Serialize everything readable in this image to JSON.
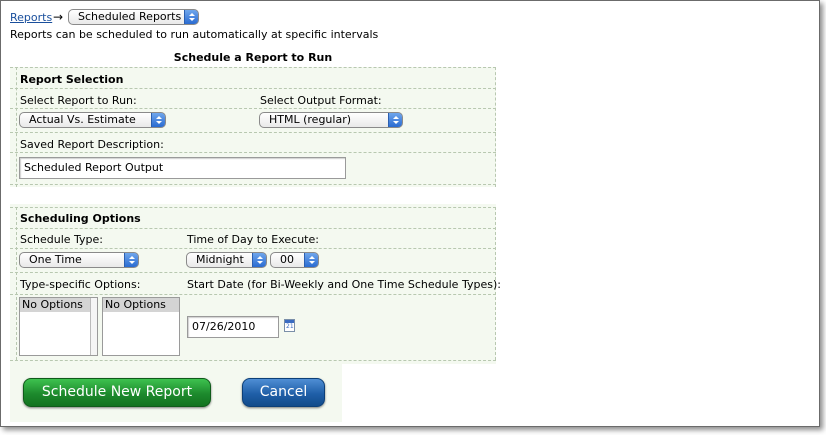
{
  "breadcrumb": {
    "link": "Reports",
    "arrow": "→",
    "current": "Scheduled Reports"
  },
  "intro": "Reports can be scheduled to run automatically at specific intervals",
  "title": "Schedule a Report to Run",
  "selection": {
    "heading": "Report Selection",
    "report_label": "Select Report to Run:",
    "report_value": "Actual Vs. Estimate",
    "format_label": "Select Output Format:",
    "format_value": "HTML (regular)",
    "desc_label": "Saved Report Description:",
    "desc_value": "Scheduled Report Output"
  },
  "scheduling": {
    "heading": "Scheduling Options",
    "type_label": "Schedule Type:",
    "type_value": "One Time",
    "time_label": "Time of Day to Execute:",
    "time_hour": "Midnight",
    "time_min": "00",
    "options_label": "Type-specific Options:",
    "options_list1": "No Options",
    "options_list2": "No Options",
    "start_label": "Start Date (for Bi-Weekly and One Time Schedule Types):",
    "start_value": "07/26/2010",
    "calendar_day": "21"
  },
  "buttons": {
    "schedule": "Schedule New Report",
    "cancel": "Cancel"
  },
  "colors": {
    "panel": "#f4f9f0",
    "link": "#1a4f9c",
    "green": "#1d8a2d",
    "blue": "#1f5fa8"
  }
}
